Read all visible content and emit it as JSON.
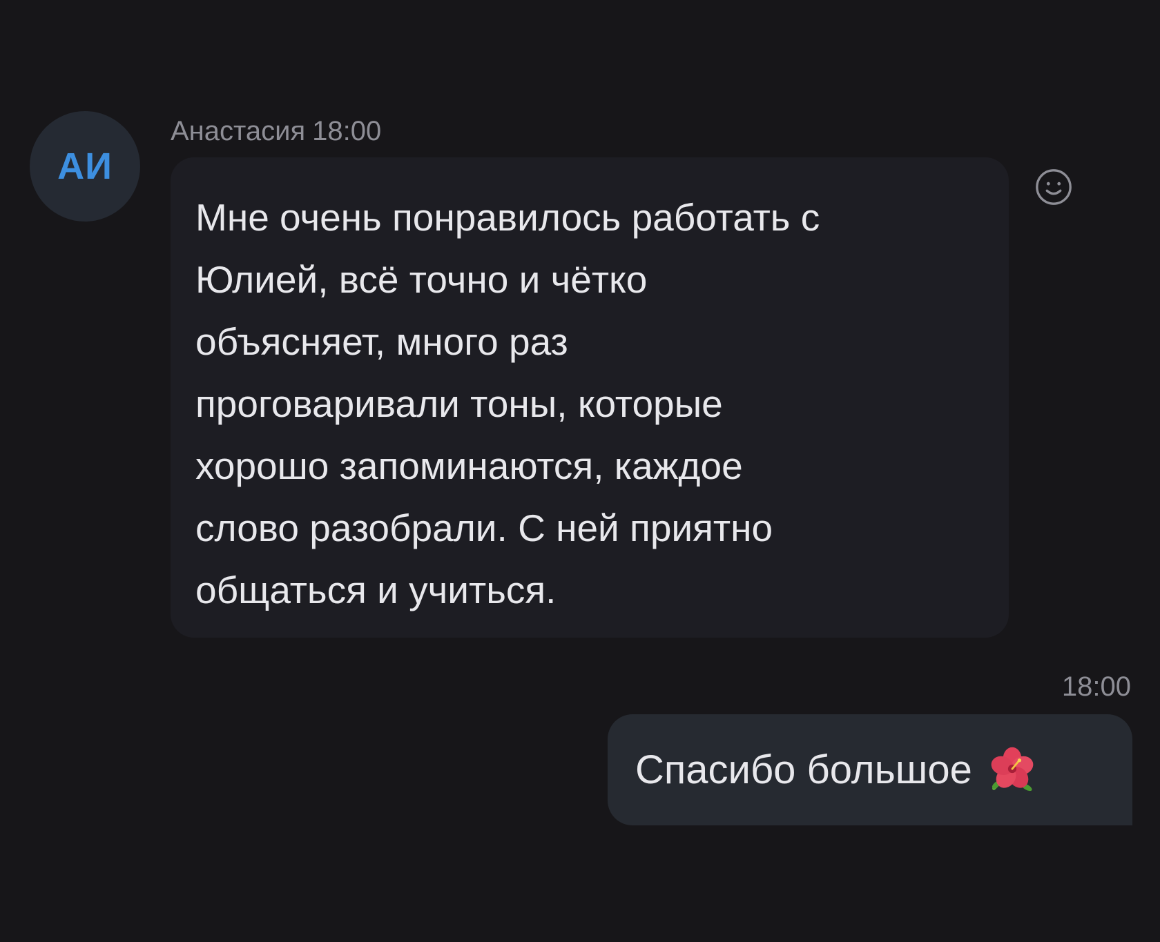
{
  "incoming": {
    "avatar_initials": "АИ",
    "sender": "Анастасия",
    "time": "18:00",
    "lines": [
      "Мне очень понравилось работать с",
      "Юлией, всё точно и чётко",
      "объясняет, много раз",
      "проговаривали тоны, которые",
      "хорошо запоминаются, каждое",
      "слово разобрали. С ней приятно",
      "общаться и учиться."
    ],
    "reaction_icon": "smiley-icon"
  },
  "outgoing": {
    "time": "18:00",
    "text": "Спасибо большое",
    "emoji_icon": "hibiscus-flower-icon"
  },
  "colors": {
    "background": "#171619",
    "incoming_bubble": "#1d1d23",
    "outgoing_bubble": "#262a31",
    "avatar_bg": "#252a33",
    "avatar_text": "#3d8fe0",
    "meta_text": "#8e8e96"
  }
}
